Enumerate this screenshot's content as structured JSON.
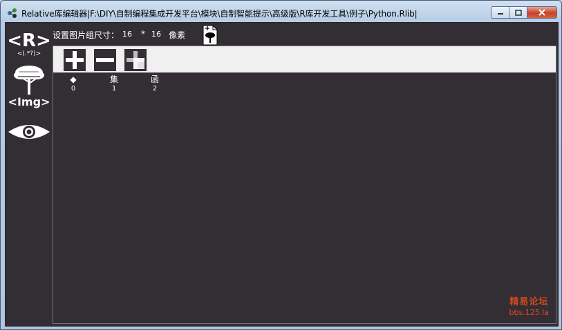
{
  "window": {
    "title": "Relative库编辑器|F:\\DIY\\自制编程集成开发平台\\模块\\自制智能提示\\高级版\\R库开发工具\\例子\\Python.Rlib|"
  },
  "sidebar": {
    "items": [
      {
        "name": "regex-r-icon",
        "label": "<R>",
        "sublabel": "<(.*?)>"
      },
      {
        "name": "tree-img-icon",
        "label": "<Img>"
      },
      {
        "name": "eye-icon",
        "label": ""
      }
    ]
  },
  "size_setting": {
    "label": "设置图片组尺寸：",
    "width": "16",
    "separator": "*",
    "height": "16",
    "unit": "像素"
  },
  "toolbar": {
    "buttons": [
      {
        "name": "add-button",
        "icon": "plus-icon"
      },
      {
        "name": "remove-button",
        "icon": "minus-icon"
      },
      {
        "name": "add-alt-button",
        "icon": "plus-shaded-icon"
      }
    ]
  },
  "items": [
    {
      "glyph": "◆",
      "index": "0"
    },
    {
      "glyph": "集",
      "index": "1"
    },
    {
      "glyph": "函",
      "index": "2"
    }
  ],
  "watermark": {
    "line1": "精易论坛",
    "line2": "bbs.125.la"
  },
  "colors": {
    "client_bg": "#332e33",
    "toolbar_bg": "#f0f0f0",
    "watermark": "#d24a1e"
  }
}
